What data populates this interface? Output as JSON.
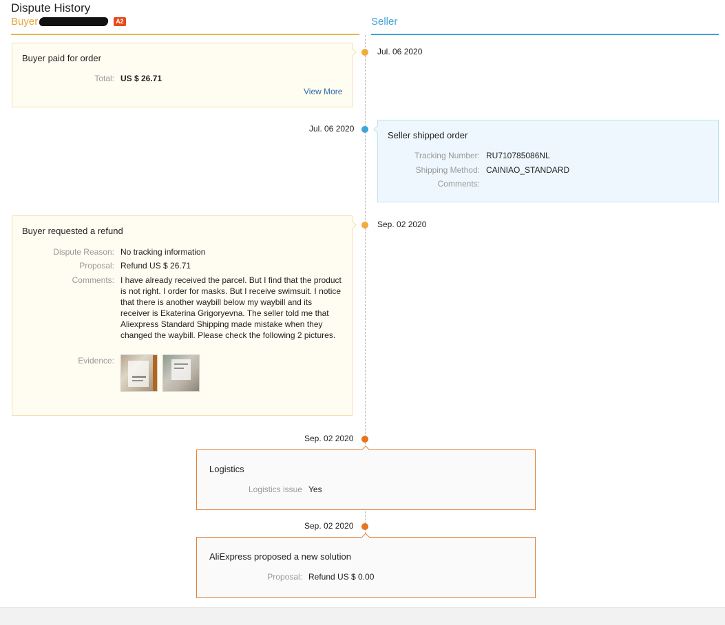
{
  "header": {
    "title": "Dispute History",
    "buyer_label": "Buyer",
    "badge": "A2",
    "seller_label": "Seller"
  },
  "colors": {
    "buyer_accent": "#e8b54a",
    "seller_accent": "#3fa4d8",
    "system_accent": "#e8741e",
    "link": "#2d6ea5"
  },
  "events": [
    {
      "side": "buyer",
      "date": "Jul. 06 2020",
      "title": "Buyer paid for order",
      "total_label": "Total:",
      "total_value": "US $ 26.71",
      "link": "View More"
    },
    {
      "side": "seller",
      "date": "Jul. 06 2020",
      "title": "Seller shipped order",
      "tracking_label": "Tracking Number:",
      "tracking_value": "RU710785086NL",
      "method_label": "Shipping Method:",
      "method_value": "CAINIAO_STANDARD",
      "comments_label": "Comments:",
      "comments_value": ""
    },
    {
      "side": "buyer",
      "date": "Sep. 02 2020",
      "title": "Buyer requested a refund",
      "reason_label": "Dispute Reason:",
      "reason_value": "No tracking information",
      "proposal_label": "Proposal:",
      "proposal_value": "Refund US $ 26.71",
      "comments_label": "Comments:",
      "comments_value": "I have already received the parcel. But I find that the product is not right. I order for masks. But I receive swimsuit. I notice that there is another waybill below my waybill and its receiver is Ekaterina Grigoryevna. The seller told me that Aliexpress Standard Shipping made mistake when they changed the waybill. Please check the following 2 pictures.",
      "evidence_label": "Evidence:"
    },
    {
      "side": "system",
      "date": "Sep. 02 2020",
      "title": "Logistics",
      "issue_label": "Logistics issue",
      "issue_value": "Yes"
    },
    {
      "side": "system",
      "date": "Sep. 02 2020",
      "title": "AliExpress proposed a new solution",
      "proposal_label": "Proposal:",
      "proposal_value": "Refund US $ 0.00"
    }
  ]
}
